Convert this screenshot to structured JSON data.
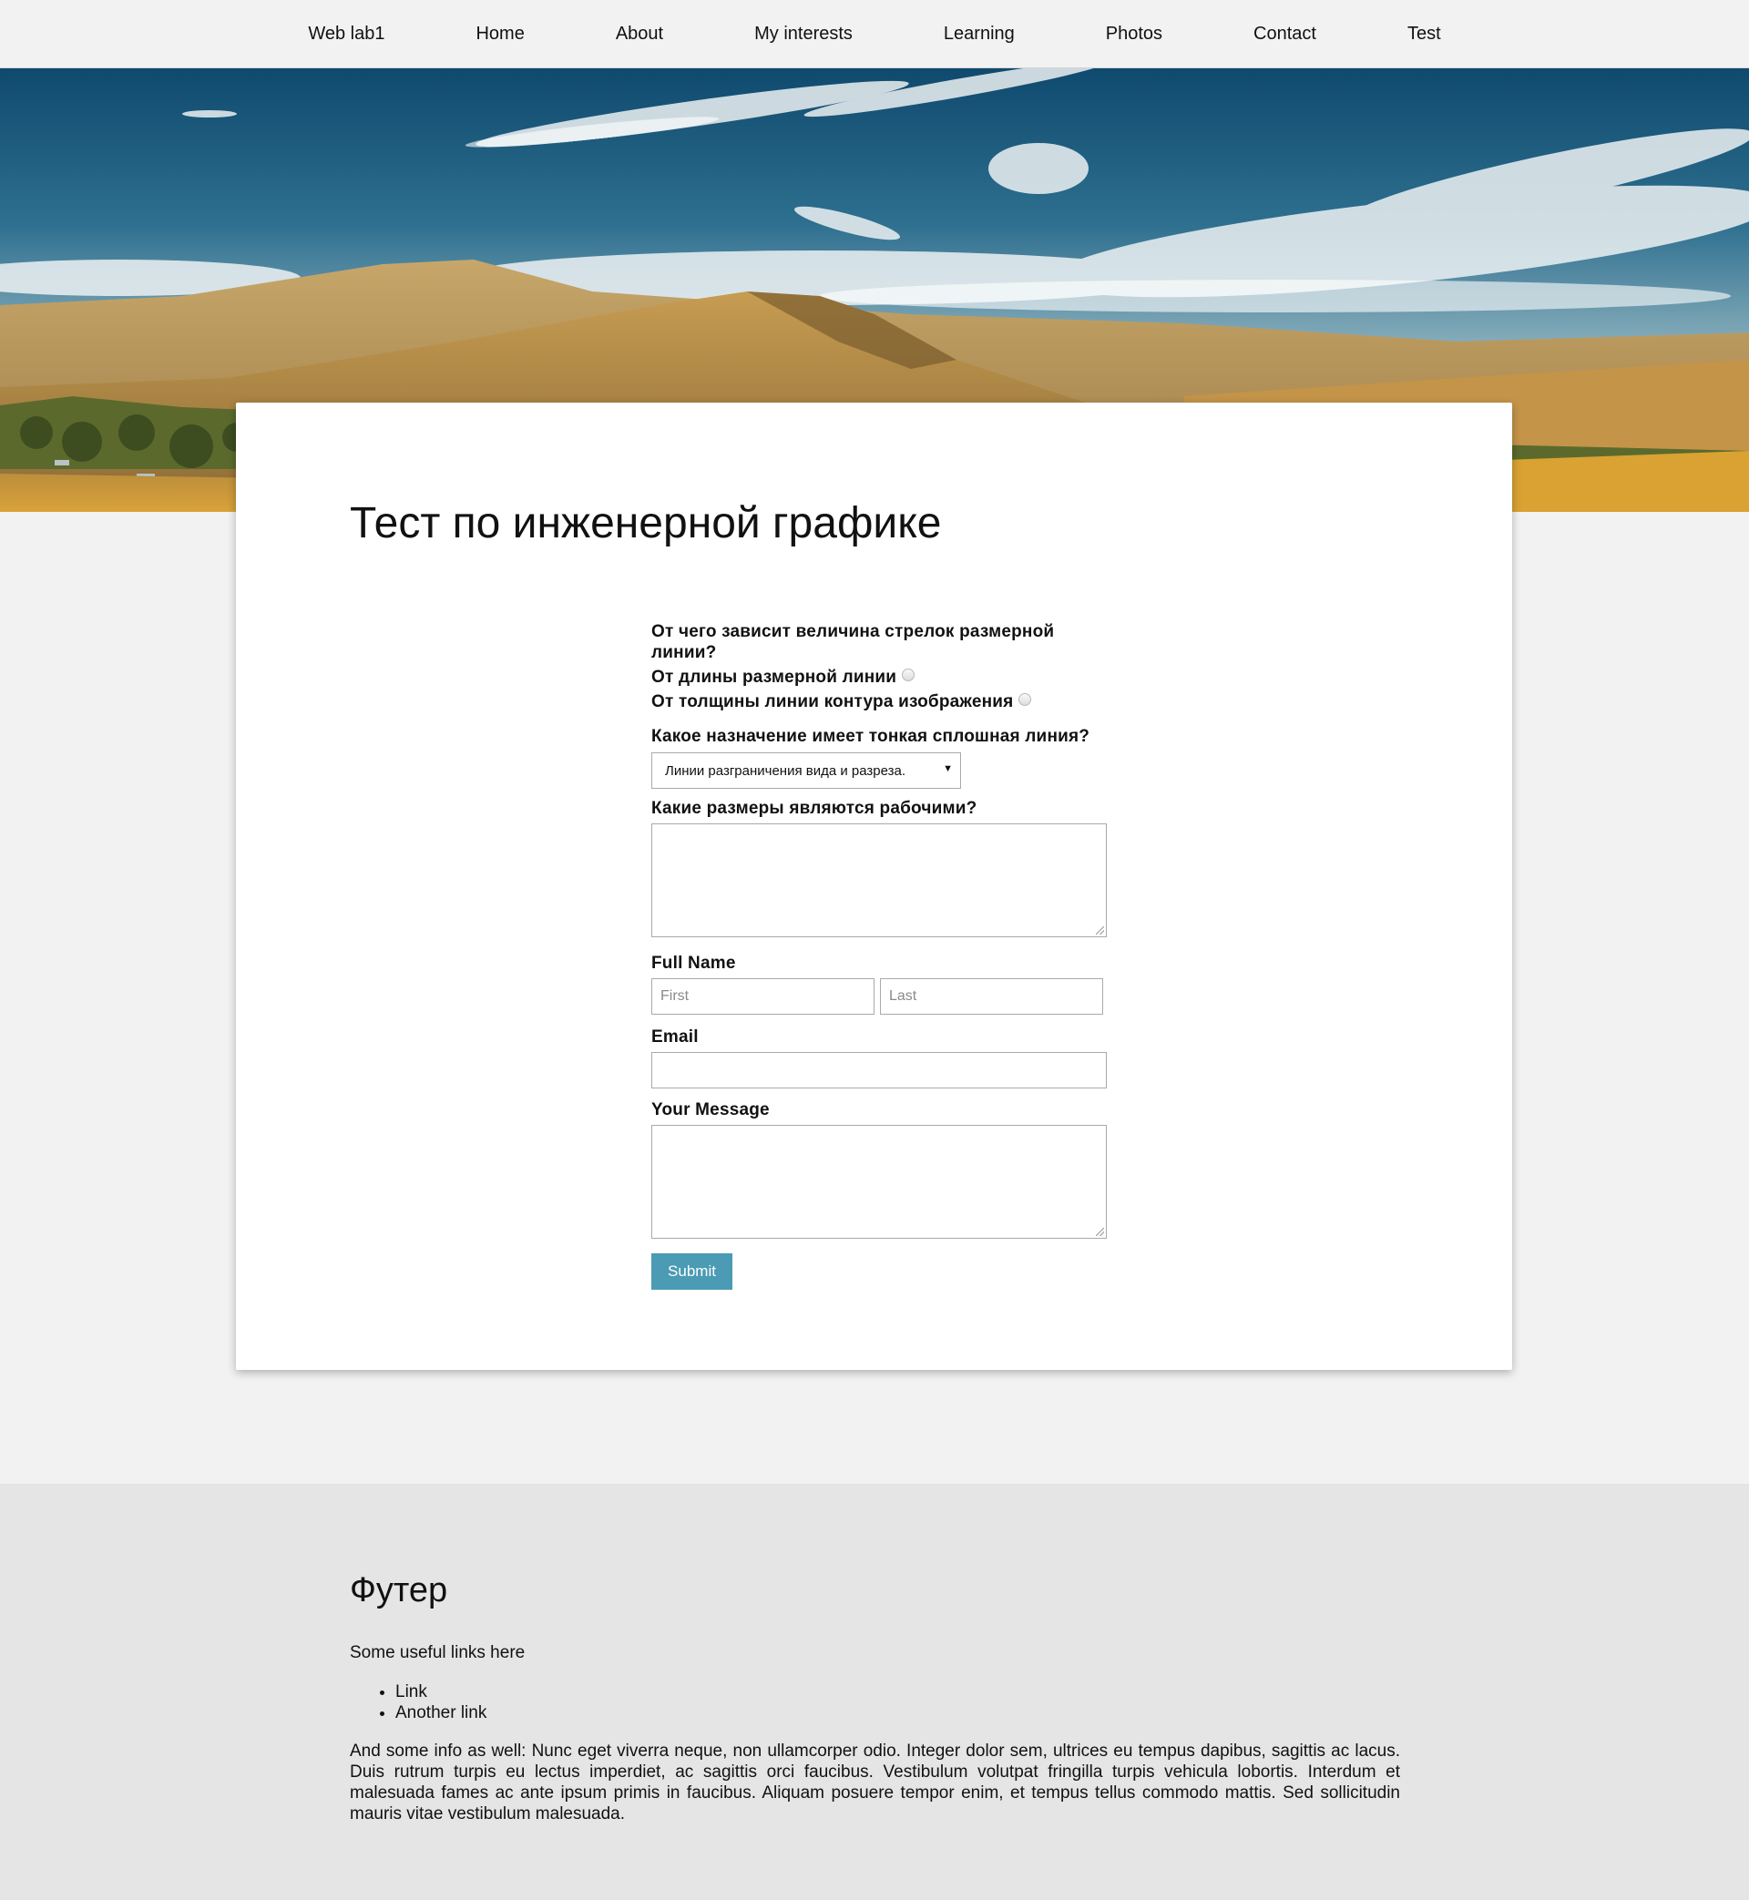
{
  "nav": {
    "items": [
      "Web lab1",
      "Home",
      "About",
      "My interests",
      "Learning",
      "Photos",
      "Contact",
      "Test"
    ]
  },
  "main": {
    "title": "Тест по инженерной графике",
    "q1": {
      "question": "От чего зависит величина стрелок размерной линии?",
      "options": [
        "От длины размерной линии",
        "От толщины линии контура изображения"
      ]
    },
    "q2": {
      "question": "Какое назначение имеет тонкая сплошная линия?",
      "selected": "Линии разграничения вида и разреза."
    },
    "q3": {
      "question": "Какие размеры являются рабочими?"
    },
    "full_name": {
      "label": "Full Name",
      "first_placeholder": "First",
      "last_placeholder": "Last"
    },
    "email": {
      "label": "Email"
    },
    "message": {
      "label": "Your Message"
    },
    "submit": "Submit"
  },
  "footer": {
    "title": "Футер",
    "intro": "Some useful links here",
    "links": [
      "Link",
      "Another link"
    ],
    "info": "And some info as well: Nunc eget viverra neque, non ullamcorper odio. Integer dolor sem, ultrices eu tempus dapibus, sagittis ac lacus. Duis rutrum turpis eu lectus imperdiet, ac sagittis orci faucibus. Vestibulum volutpat fringilla turpis vehicula lobortis. Interdum et malesuada fames ac ante ipsum primis in faucibus. Aliquam posuere tempor enim, et tempus tellus commodo mattis. Sed sollicitudin mauris vitae vestibulum malesuada."
  },
  "colors": {
    "accent": "#4a9bb3",
    "page_bg": "#f2f2f2",
    "footer_bg": "#e5e5e5"
  }
}
